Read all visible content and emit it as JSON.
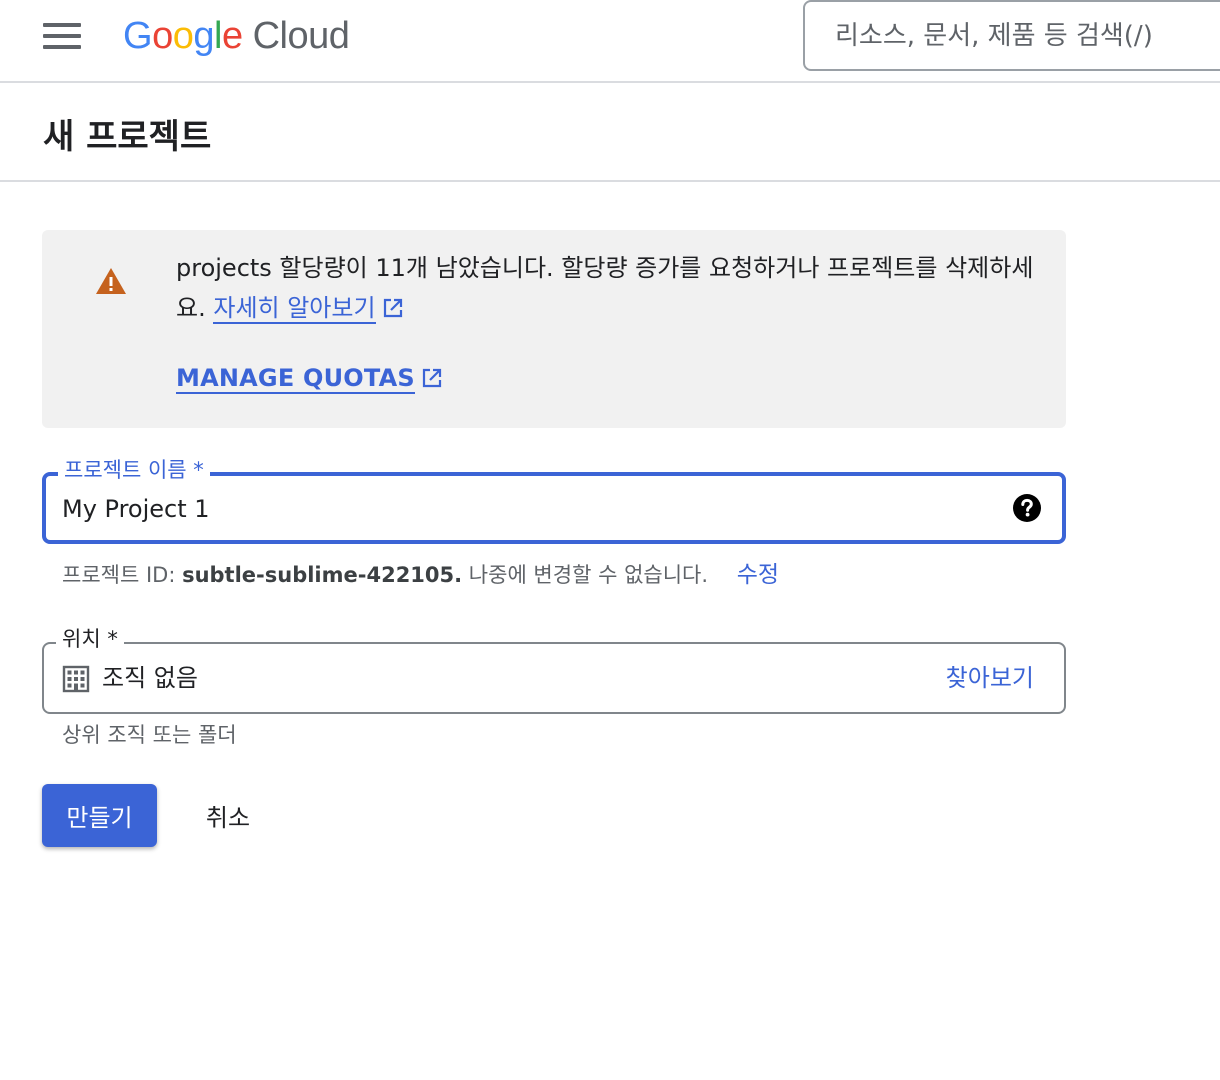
{
  "header": {
    "logo_word": "Google",
    "logo_product": "Cloud",
    "logo_colors": [
      "#4285F4",
      "#EA4335",
      "#FBBC05",
      "#4285F4",
      "#34A853",
      "#EA4335"
    ],
    "menu_icon": "hamburger-menu-icon",
    "search_placeholder": "리소스, 문서, 제품 등 검색(/)"
  },
  "page": {
    "title": "새 프로젝트"
  },
  "alert": {
    "icon": "warning-icon",
    "icon_color": "#c5621e",
    "message": "projects 할당량이 11개 남았습니다. 할당량 증가를 요청하거나 프로젝트를 삭제하세요.",
    "learn_more": "자세히 알아보기",
    "manage_quotas": "MANAGE QUOTAS"
  },
  "form": {
    "name_label": "프로젝트 이름 *",
    "name_value": "My Project 1",
    "project_id_prefix": "프로젝트 ID: ",
    "project_id": "subtle-sublime-422105.",
    "project_id_suffix": " 나중에 변경할 수 없습니다.",
    "edit_label": "수정",
    "location_label": "위치 *",
    "location_value": "조직 없음",
    "browse_label": "찾아보기",
    "location_hint": "상위 조직 또는 폴더"
  },
  "actions": {
    "create": "만들기",
    "cancel": "취소"
  },
  "colors": {
    "accent": "#3b64d6",
    "alert_bg": "#f1f1f1"
  }
}
